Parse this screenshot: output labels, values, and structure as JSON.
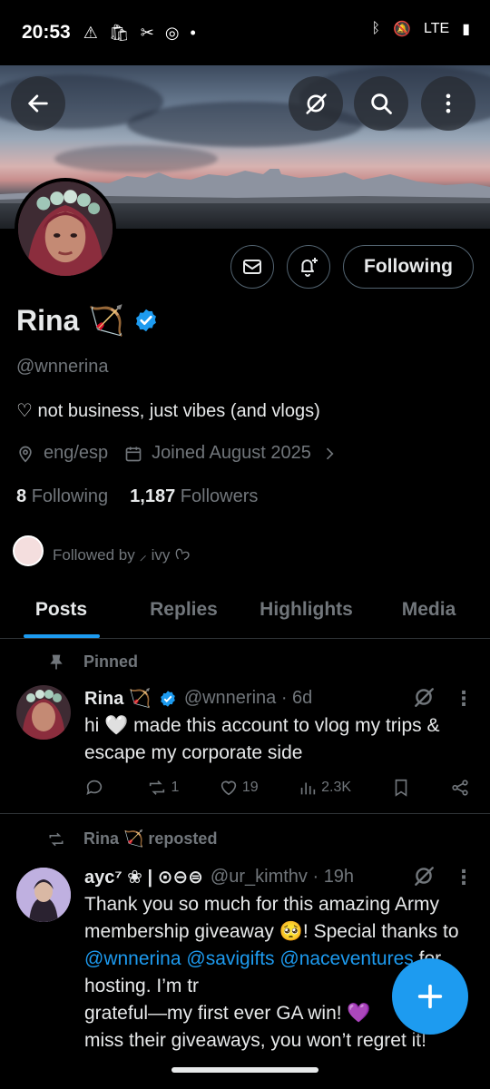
{
  "status_bar": {
    "time": "20:53",
    "network": "LTE"
  },
  "profile": {
    "name": "Rina",
    "name_emoji": "🏹",
    "handle": "@wnnerina",
    "bio": "♡ not business, just vibes (and vlogs)",
    "location": "eng/esp",
    "joined": "Joined August 2025",
    "following_count": "8",
    "following_label": "Following",
    "followers_count": "1,187",
    "followers_label": "Followers",
    "followed_by": "Followed by ⸝ ivy ᢉ𐭩",
    "follow_button": "Following"
  },
  "tabs": [
    {
      "label": "Posts",
      "active": true
    },
    {
      "label": "Replies",
      "active": false
    },
    {
      "label": "Highlights",
      "active": false
    },
    {
      "label": "Media",
      "active": false
    }
  ],
  "tweets": [
    {
      "social_context": "Pinned",
      "name": "Rina 🏹",
      "handle": "@wnnerina · 6d",
      "text": "hi 🤍 made this account to vlog my trips & escape my corporate side",
      "replies": "",
      "reposts": "1",
      "likes": "19",
      "views": "2.3K"
    },
    {
      "social_context": "Rina 🏹 reposted",
      "name": "ayc⁷ ❀ | ⊙⊖⊜",
      "handle": "@ur_kimthv · 19h",
      "text_parts": [
        "Thank you so much for this amazing Army membership giveaway 🥺! Special thanks to ",
        "@wnnerina @savigifts @naceventures",
        " for hosting. I’m tr",
        "grateful—my first ever GA win! 💜",
        "miss their giveaways, you won’t regret it!"
      ]
    }
  ],
  "colors": {
    "accent": "#1d9bf0",
    "text_primary": "#e7e9ea",
    "text_secondary": "#71767b",
    "border": "#2f3336",
    "background": "#000000"
  },
  "icons": [
    "back-icon",
    "grok-icon",
    "search-icon",
    "more-icon",
    "mail-icon",
    "bell-plus-icon",
    "verified-icon",
    "location-icon",
    "calendar-icon",
    "chevron-right-icon",
    "pin-icon",
    "repost-icon",
    "reply-icon",
    "like-icon",
    "views-icon",
    "bookmark-icon",
    "share-icon",
    "plus-icon"
  ]
}
